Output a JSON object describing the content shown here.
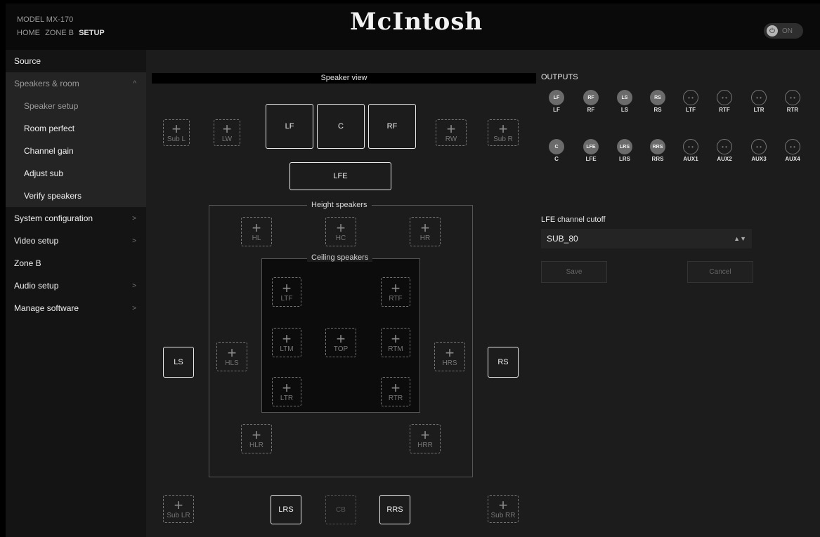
{
  "header": {
    "model": "MODEL MX-170",
    "nav": [
      "HOME",
      "ZONE B",
      "SETUP"
    ],
    "logo": "McIntosh",
    "power_label": "ON",
    "power_icon": "⏻"
  },
  "sidebar": {
    "items": [
      {
        "label": "Source"
      },
      {
        "label": "Speakers & room",
        "chevron": "^"
      },
      {
        "label": "Speaker setup"
      },
      {
        "label": "Room perfect"
      },
      {
        "label": "Channel gain"
      },
      {
        "label": "Adjust sub"
      },
      {
        "label": "Verify speakers"
      },
      {
        "label": "System configuration",
        "chevron": ">"
      },
      {
        "label": "Video setup",
        "chevron": ">"
      },
      {
        "label": "Zone B"
      },
      {
        "label": "Audio setup",
        "chevron": ">"
      },
      {
        "label": "Manage software",
        "chevron": ">"
      }
    ]
  },
  "speaker_view": {
    "title": "Speaker view",
    "height_label": "Height speakers",
    "ceiling_label": "Ceiling speakers",
    "plus": "+",
    "front": {
      "sub_l": "Sub L",
      "lw": "LW",
      "lf": "LF",
      "c": "C",
      "rf": "RF",
      "rw": "RW",
      "sub_r": "Sub R",
      "lfe": "LFE"
    },
    "height": {
      "hl": "HL",
      "hc": "HC",
      "hr": "HR",
      "hls": "HLS",
      "hrs": "HRS",
      "hlr": "HLR",
      "hrr": "HRR"
    },
    "ceiling": {
      "ltf": "LTF",
      "rtf": "RTF",
      "ltm": "LTM",
      "top": "TOP",
      "rtm": "RTM",
      "ltr": "LTR",
      "rtr": "RTR"
    },
    "side": {
      "ls": "LS",
      "rs": "RS"
    },
    "rear": {
      "sub_lr": "Sub LR",
      "lrs": "LRS",
      "cb": "CB",
      "rrs": "RRS",
      "sub_rr": "Sub RR"
    }
  },
  "outputs": {
    "title": "OUTPUTS",
    "row1": [
      {
        "dot": "LF",
        "name": "LF",
        "active": true
      },
      {
        "dot": "RF",
        "name": "RF",
        "active": true
      },
      {
        "dot": "LS",
        "name": "LS",
        "active": true
      },
      {
        "dot": "RS",
        "name": "RS",
        "active": true
      },
      {
        "dot": "• •",
        "name": "LTF",
        "active": false
      },
      {
        "dot": "• •",
        "name": "RTF",
        "active": false
      },
      {
        "dot": "• •",
        "name": "LTR",
        "active": false
      },
      {
        "dot": "• •",
        "name": "RTR",
        "active": false
      }
    ],
    "row2": [
      {
        "dot": "C",
        "name": "C",
        "active": true
      },
      {
        "dot": "LFE",
        "name": "LFE",
        "active": true
      },
      {
        "dot": "LRS",
        "name": "LRS",
        "active": true
      },
      {
        "dot": "RRS",
        "name": "RRS",
        "active": true
      },
      {
        "dot": "• •",
        "name": "AUX1",
        "active": false
      },
      {
        "dot": "• •",
        "name": "AUX2",
        "active": false
      },
      {
        "dot": "• •",
        "name": "AUX3",
        "active": false
      },
      {
        "dot": "• •",
        "name": "AUX4",
        "active": false
      }
    ]
  },
  "lfe": {
    "label": "LFE channel cutoff",
    "value": "SUB_80",
    "arrows": "▲▼"
  },
  "actions": {
    "save": "Save",
    "cancel": "Cancel"
  }
}
